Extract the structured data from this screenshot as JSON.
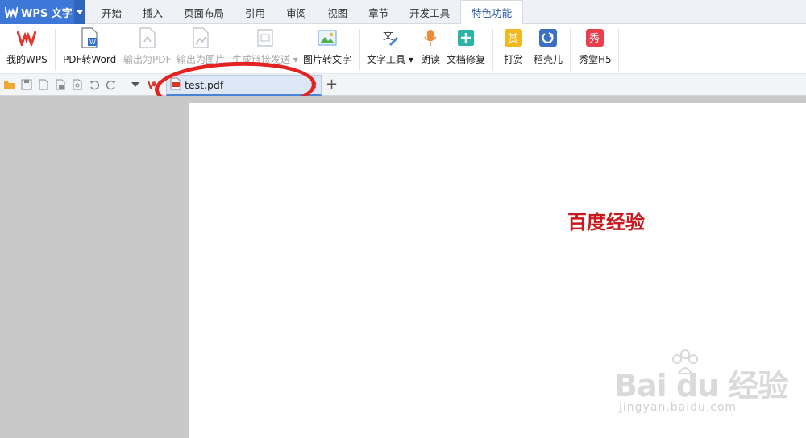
{
  "app": {
    "title": "WPS 文字"
  },
  "menu_tabs": [
    "开始",
    "插入",
    "页面布局",
    "引用",
    "审阅",
    "视图",
    "章节",
    "开发工具",
    "特色功能"
  ],
  "active_tab": "特色功能",
  "ribbon": {
    "my_wps": "我的WPS",
    "pdf_to_word": "PDF转Word",
    "export_pdf": "输出为PDF",
    "export_image": "输出为图片",
    "gen_link_send": "生成链接发送",
    "image_to_text": "图片转文字",
    "text_tools": "文字工具",
    "read_aloud": "朗读",
    "doc_repair": "文档修复",
    "tip": "打赏",
    "daoke": "稻壳儿",
    "xiutang": "秀堂H5"
  },
  "icons": {
    "qa": [
      "open-folder-icon",
      "save-icon",
      "save-as-icon",
      "export-pdf-icon",
      "print-preview-icon",
      "undo-icon",
      "redo-icon",
      "dropdown-arrow-icon"
    ]
  },
  "document_tab": {
    "name": "test.pdf"
  },
  "page": {
    "text": "百度经验"
  },
  "watermark": {
    "main": "Bai du 经验",
    "sub": "jingyan.baidu.com"
  },
  "colors": {
    "app_blue": "#3d78d8",
    "highlight_red": "#e32222",
    "page_text_red": "#c8191e"
  }
}
